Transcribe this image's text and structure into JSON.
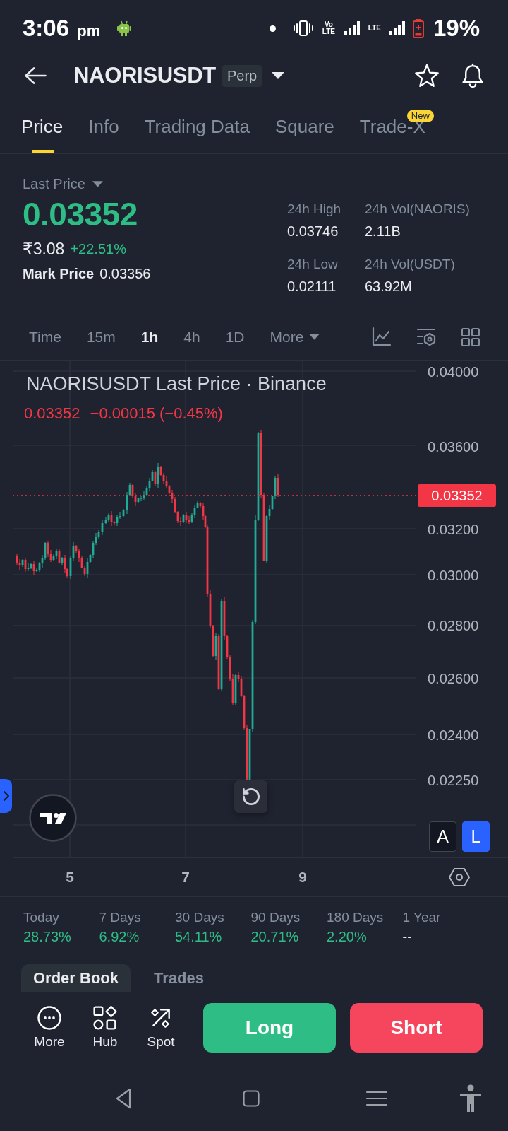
{
  "status_bar": {
    "time": "3:06",
    "meridiem": "pm",
    "volte": "Vo LTE",
    "lte": "LTE",
    "battery": "19%"
  },
  "header": {
    "title": "NAORISUSDT",
    "tag": "Perp"
  },
  "tabs": [
    {
      "label": "Price",
      "selected": true
    },
    {
      "label": "Info",
      "selected": false
    },
    {
      "label": "Trading Data",
      "selected": false
    },
    {
      "label": "Square",
      "selected": false
    },
    {
      "label": "Trade-X",
      "selected": false,
      "badge": "New"
    }
  ],
  "price": {
    "label": "Last Price",
    "value": "0.03352",
    "fiat": "₹3.08",
    "change": "+22.51%",
    "mark_label": "Mark Price",
    "mark_value": "0.03356"
  },
  "stats": [
    {
      "label": "24h High",
      "value": "0.03746"
    },
    {
      "label": "24h Vol(NAORIS)",
      "value": "2.11B"
    },
    {
      "label": "24h Low",
      "value": "0.02111"
    },
    {
      "label": "24h Vol(USDT)",
      "value": "63.92M"
    }
  ],
  "intervals": [
    {
      "label": "Time",
      "kind": "option",
      "selected": false
    },
    {
      "label": "15m",
      "kind": "option",
      "selected": false
    },
    {
      "label": "1h",
      "kind": "option",
      "selected": true
    },
    {
      "label": "4h",
      "kind": "option",
      "selected": false
    },
    {
      "label": "1D",
      "kind": "option",
      "selected": false
    },
    {
      "label": "More",
      "kind": "menu",
      "selected": false
    }
  ],
  "chart": {
    "title": "NAORISUSDT Last Price · Binance",
    "quote_price": "0.03352",
    "quote_change": "−0.00015 (−0.45%)",
    "price_axis": [
      "0.04000",
      "0.03600",
      "0.03200",
      "0.03000",
      "0.02800",
      "0.02600",
      "0.02400",
      "0.02250"
    ],
    "last_price_tag": "0.03352",
    "time_axis": [
      "5",
      "7",
      "9"
    ],
    "scale_buttons": [
      {
        "label": "A",
        "selected": false
      },
      {
        "label": "L",
        "selected": true
      }
    ]
  },
  "performance": [
    {
      "label": "Today",
      "value": "28.73%",
      "kind": "gain"
    },
    {
      "label": "7 Days",
      "value": "6.92%",
      "kind": "gain"
    },
    {
      "label": "30 Days",
      "value": "54.11%",
      "kind": "gain"
    },
    {
      "label": "90 Days",
      "value": "20.71%",
      "kind": "gain"
    },
    {
      "label": "180 Days",
      "value": "2.20%",
      "kind": "gain"
    },
    {
      "label": "1 Year",
      "value": "--",
      "kind": "blank"
    }
  ],
  "book_tabs": [
    {
      "label": "Order Book",
      "selected": true
    },
    {
      "label": "Trades",
      "selected": false
    }
  ],
  "actions": [
    {
      "label": "More",
      "kind": "more"
    },
    {
      "label": "Hub",
      "kind": "hub"
    },
    {
      "label": "Spot",
      "kind": "spot"
    }
  ],
  "trade_buttons": [
    {
      "label": "Long",
      "kind": "long"
    },
    {
      "label": "Short",
      "kind": "short"
    }
  ]
}
